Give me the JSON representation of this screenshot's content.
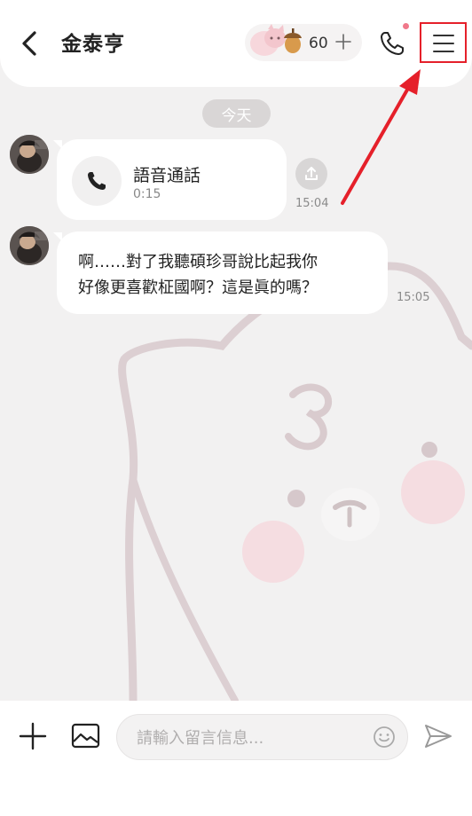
{
  "header": {
    "contact_name": "金泰亨",
    "coin_count": "60",
    "back_icon": "chevron-left-icon",
    "call_icon": "phone-icon",
    "menu_icon": "hamburger-menu-icon"
  },
  "chat": {
    "date_label": "今天",
    "messages": [
      {
        "type": "voice-call",
        "title": "語音通話",
        "duration": "0:15",
        "time": "15:04"
      },
      {
        "type": "text",
        "lines": [
          "啊……對了我聽碩珍哥說比起我你",
          "好像更喜歡柾國啊？這是眞的嗎？"
        ],
        "time": "15:05"
      }
    ]
  },
  "input_bar": {
    "placeholder": "請輸入留言信息...",
    "value": ""
  },
  "colors": {
    "annotation_red": "#e5202a",
    "notify_dot": "#f0788a",
    "bubble": "#ffffff",
    "background": "#f2f1f1"
  }
}
